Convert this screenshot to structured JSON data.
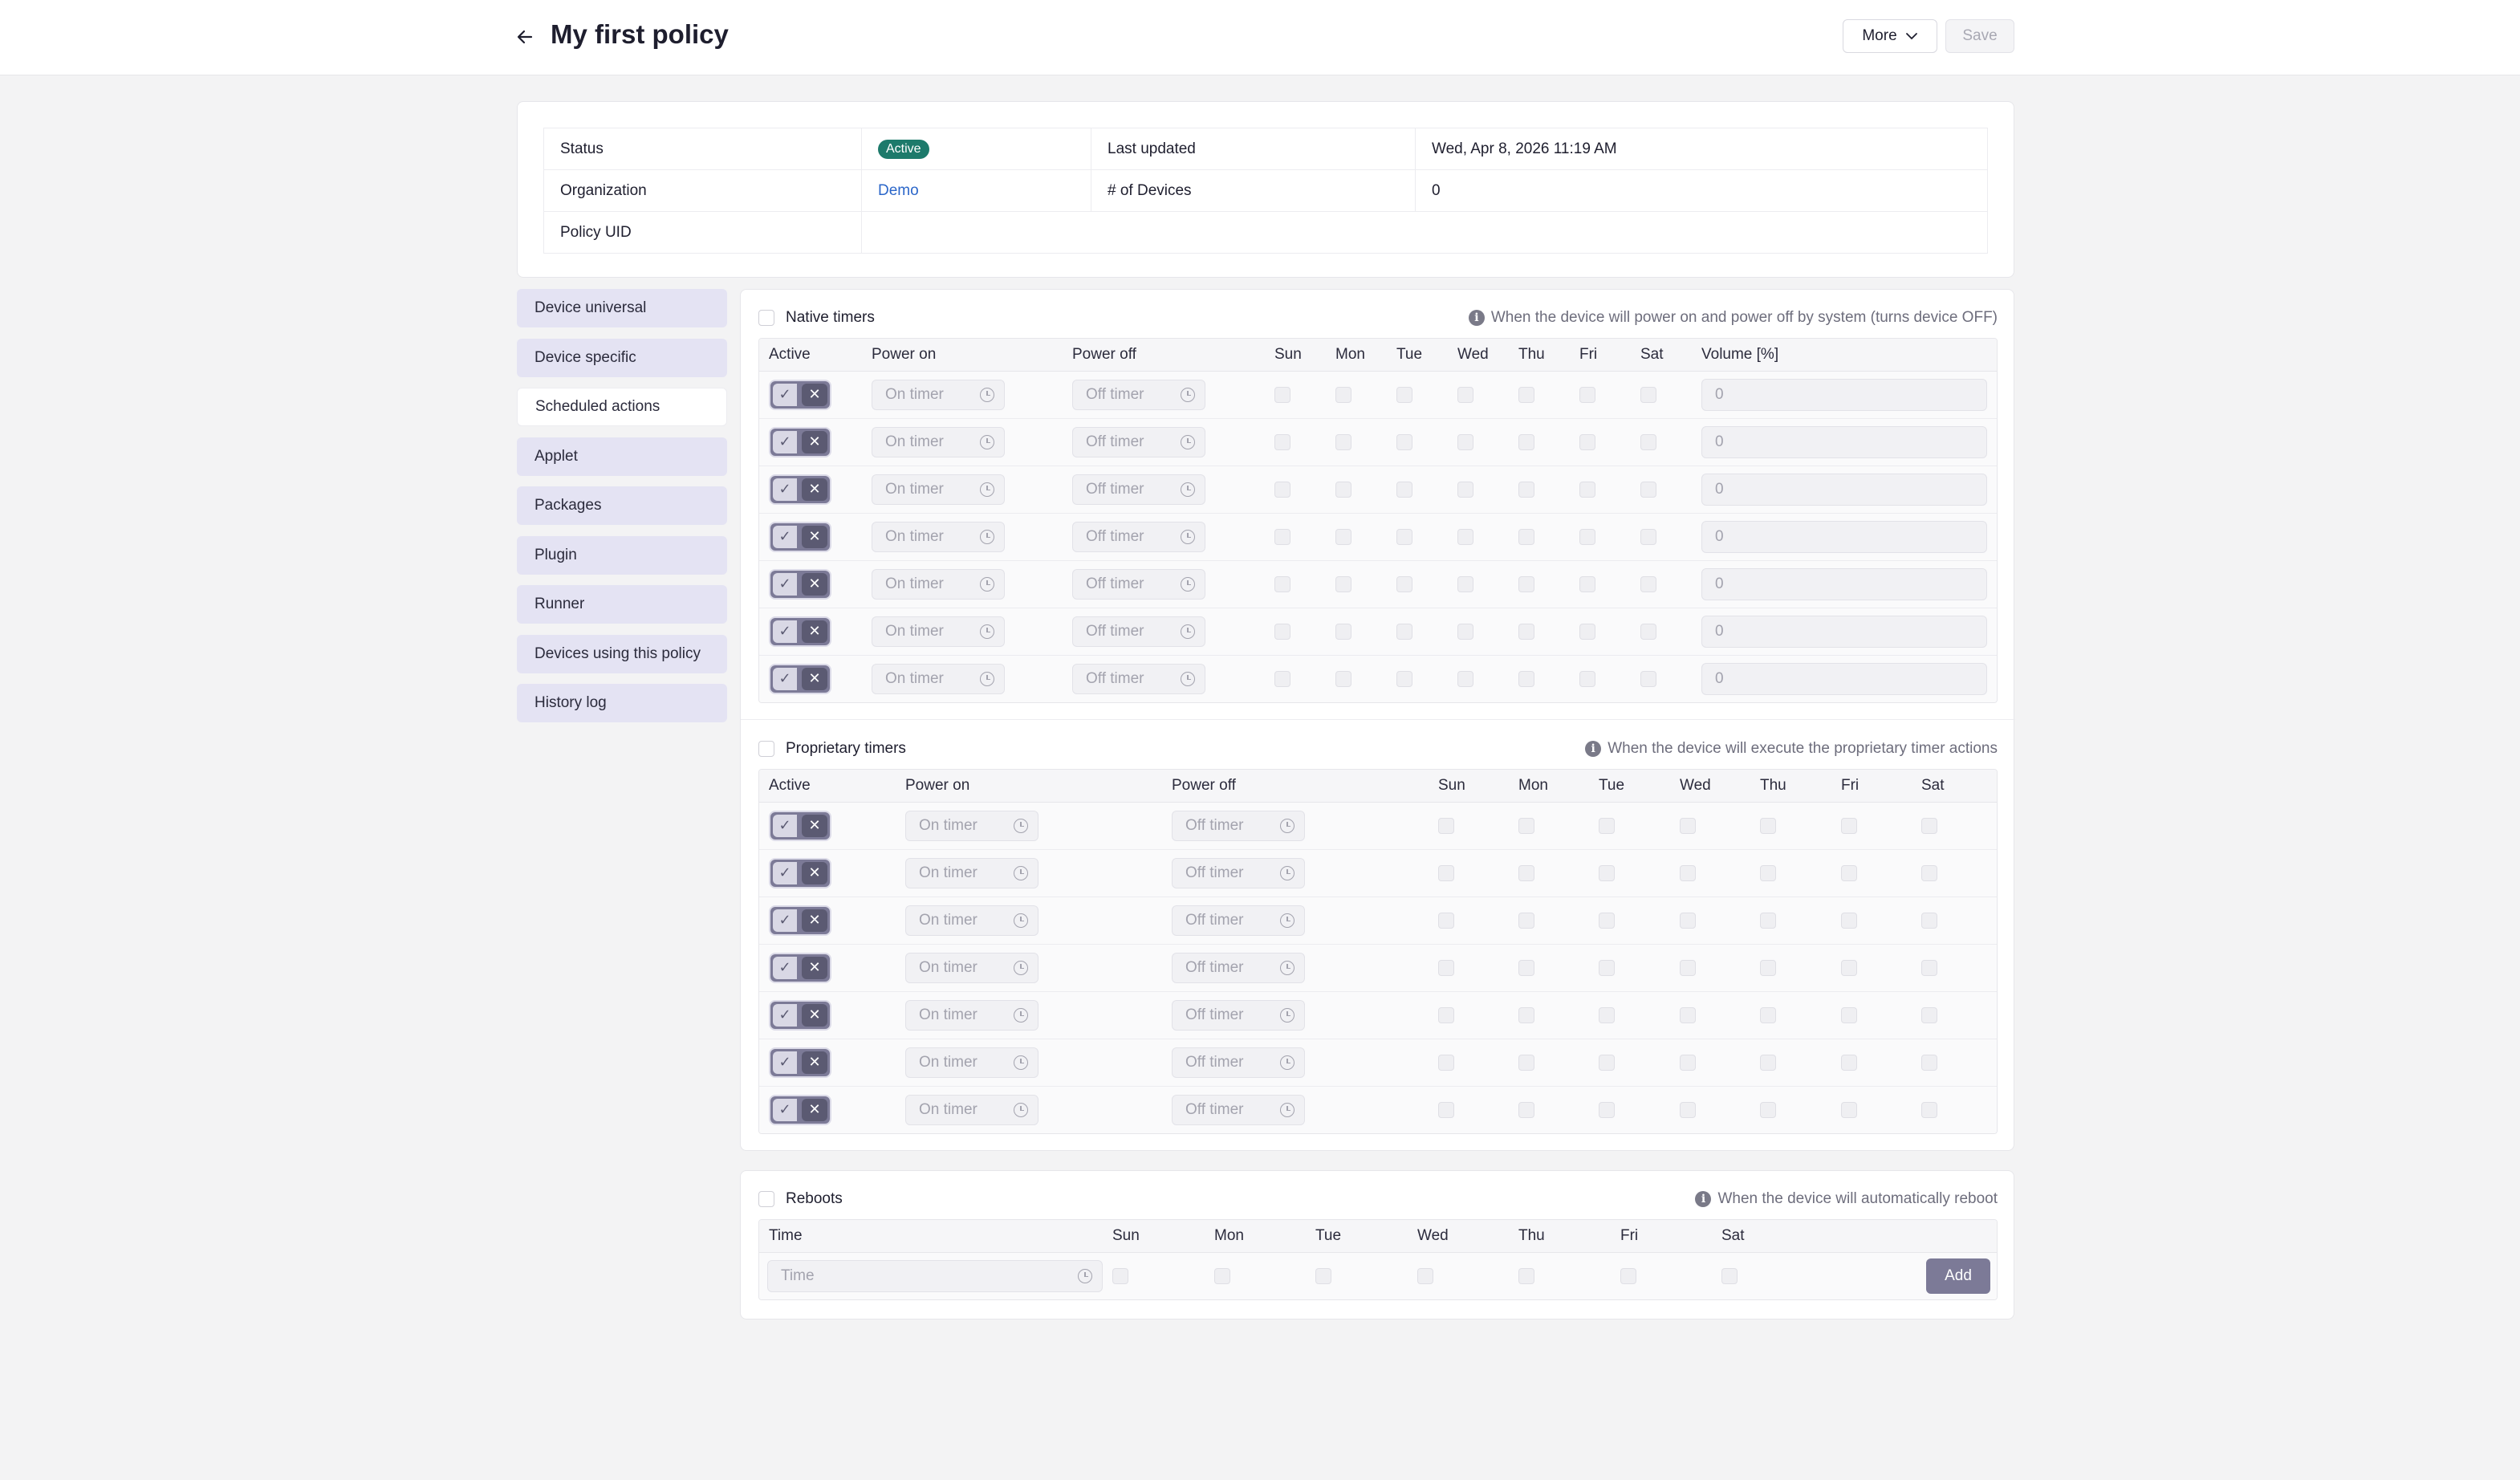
{
  "header": {
    "title": "My first policy",
    "more_label": "More",
    "save_label": "Save"
  },
  "info": {
    "status_label": "Status",
    "status_value": "Active",
    "last_updated_label": "Last updated",
    "last_updated_value": "Wed, Apr 8, 2026 11:19 AM",
    "organization_label": "Organization",
    "organization_value": "Demo",
    "devices_label": "# of Devices",
    "devices_value": "0",
    "uid_label": "Policy UID",
    "uid_value": ""
  },
  "sidebar": {
    "items": [
      {
        "label": "Device universal"
      },
      {
        "label": "Device specific"
      },
      {
        "label": "Scheduled actions",
        "active": true
      },
      {
        "label": "Applet"
      },
      {
        "label": "Packages"
      },
      {
        "label": "Plugin"
      },
      {
        "label": "Runner"
      },
      {
        "label": "Devices using this policy"
      },
      {
        "label": "History log"
      }
    ]
  },
  "native": {
    "title": "Native timers",
    "hint": "When the device will power on and power off by system (turns device OFF)",
    "columns": [
      "Active",
      "Power on",
      "Power off",
      "Sun",
      "Mon",
      "Tue",
      "Wed",
      "Thu",
      "Fri",
      "Sat",
      "Volume [%]"
    ],
    "on_placeholder": "On timer",
    "off_placeholder": "Off timer",
    "volume_value": "0",
    "row_count": 7
  },
  "proprietary": {
    "title": "Proprietary timers",
    "hint": "When the device will execute the proprietary timer actions",
    "columns": [
      "Active",
      "Power on",
      "Power off",
      "Sun",
      "Mon",
      "Tue",
      "Wed",
      "Thu",
      "Fri",
      "Sat"
    ],
    "on_placeholder": "On timer",
    "off_placeholder": "Off timer",
    "row_count": 7
  },
  "reboots": {
    "title": "Reboots",
    "hint": "When the device will automatically reboot",
    "columns": [
      "Time",
      "Sun",
      "Mon",
      "Tue",
      "Wed",
      "Thu",
      "Fri",
      "Sat"
    ],
    "time_placeholder": "Time",
    "add_label": "Add"
  },
  "icons": {
    "back": "arrow-left-icon",
    "chevron": "chevron-down-icon",
    "info": "info-icon",
    "clock": "clock-icon",
    "check": "check-icon",
    "close": "close-icon"
  },
  "colors": {
    "accent": "#7c7a97",
    "badge": "#1d7a6b",
    "link": "#2b66c9",
    "nav_bg": "#e4e3f3"
  }
}
